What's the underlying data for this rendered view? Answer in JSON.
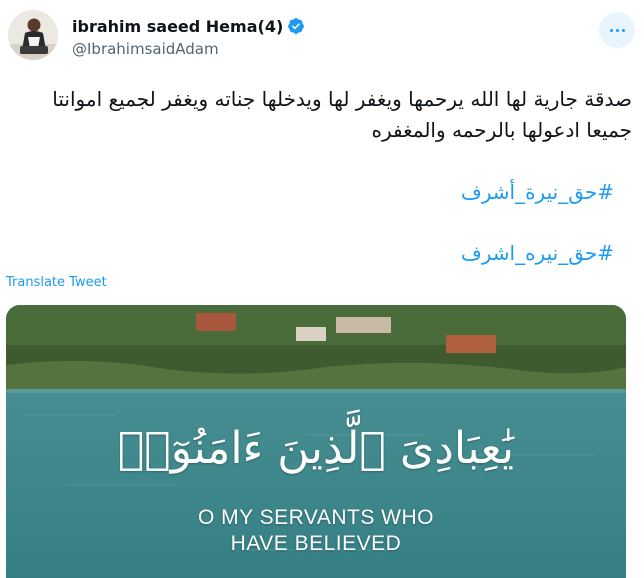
{
  "author": {
    "display_name": "ibrahim saeed Hema(4)",
    "handle": "@IbrahimsaidAdam",
    "avatar_icon": "person-photo-avatar",
    "verified_icon": "verified-badge-icon",
    "verified_color": "#1d9bf0"
  },
  "more_menu_icon": "more-horizontal-icon",
  "tweet": {
    "text": "صدقة جارية لها الله يرحمها ويغفر لها ويدخلها جناته ويغفر لجميع اموانتا جميعا ادعولها بالرحمه والمغفره",
    "hashtags": [
      "#حق_نيرة_أشرف",
      "#حق_نيره_اشرف"
    ],
    "translate_label": "Translate Tweet"
  },
  "media": {
    "arabic_text": "يَٰعِبَادِىَ ٱلَّذِينَ ءَامَنُوٓا۟",
    "english_line1": "O MY SERVANTS WHO",
    "english_line2": "HAVE BELIEVED",
    "water_color": "#3f8b8f",
    "shore_color": "#3e5a2e"
  },
  "colors": {
    "link": "#1d9bf0",
    "text": "#0f1419",
    "secondary": "#536471"
  }
}
